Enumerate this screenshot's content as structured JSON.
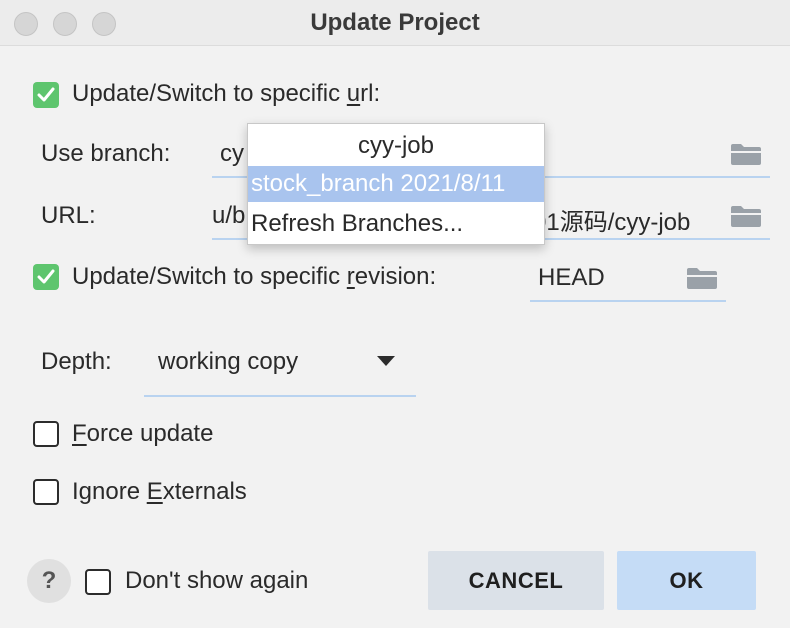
{
  "window": {
    "title": "Update Project"
  },
  "options": {
    "update_switch_url": {
      "label_before": "Update/Switch to specific ",
      "label_mnemonic": "u",
      "label_after": "rl:",
      "checked": true
    },
    "use_branch": {
      "label": "Use branch:",
      "value_visible": "cy"
    },
    "url": {
      "label": "URL:",
      "value_left": "u/b",
      "value_right": "01源码/cyy-job"
    },
    "update_switch_revision": {
      "label_before": "Update/Switch to specific ",
      "label_mnemonic": "r",
      "label_after": "evision:",
      "checked": true,
      "value": "HEAD"
    },
    "depth": {
      "label": "Depth:",
      "value": "working copy"
    },
    "force_update": {
      "label_mnemonic": "F",
      "label_after": "orce update",
      "checked": false
    },
    "ignore_externals": {
      "label_before": "Ignore ",
      "label_mnemonic": "E",
      "label_after": "xternals",
      "checked": false
    }
  },
  "branch_dropdown": {
    "items": [
      "cyy-job",
      "stock_branch 2021/8/11",
      "Refresh Branches..."
    ],
    "selected_index": 1
  },
  "footer": {
    "help_label": "?",
    "dont_show_again": "Don't show again",
    "dont_show_checked": false,
    "cancel_label": "CANCEL",
    "ok_label": "OK"
  },
  "colors": {
    "checkbox_on": "#5ec56e",
    "field_underline": "#b9d3f0",
    "selection": "#a9c4ee",
    "ok_button": "#c5dcf6",
    "cancel_button": "#dbe1e8"
  },
  "icons": {
    "traffic_lights": [
      "close-icon",
      "minimize-icon",
      "zoom-icon"
    ],
    "browse": "folder-icon",
    "check": "checkmark-icon",
    "combo": "chevron-down-icon"
  }
}
